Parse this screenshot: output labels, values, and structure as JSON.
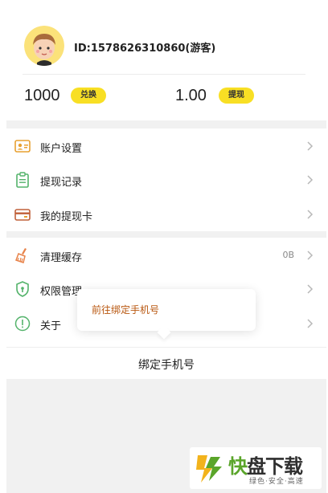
{
  "profile": {
    "user_id": "ID:1578626310860(游客)"
  },
  "stats": {
    "points_value": "1000",
    "exchange_label": "兑换",
    "balance_value": "1.00",
    "withdraw_label": "提现"
  },
  "menu_group_1": [
    {
      "label": "账户设置",
      "icon": "account-card-icon"
    },
    {
      "label": "提现记录",
      "icon": "clipboard-icon"
    },
    {
      "label": "我的提现卡",
      "icon": "wallet-icon"
    }
  ],
  "menu_group_2": [
    {
      "label": "清理缓存",
      "value": "0B",
      "icon": "broom-icon"
    },
    {
      "label": "权限管理",
      "icon": "shield-icon"
    },
    {
      "label": "关于",
      "icon": "info-icon"
    }
  ],
  "popup": {
    "text": "前往绑定手机号"
  },
  "bind_bar": {
    "label": "绑定手机号"
  },
  "watermark": {
    "title_part1": "快",
    "title_part2": "盘下载",
    "subtitle": "绿色·安全·高速"
  },
  "colors": {
    "accent_yellow": "#f8df24",
    "popup_text": "#b8560e",
    "icon_orange": "#e8834a",
    "icon_green": "#54b36b"
  }
}
